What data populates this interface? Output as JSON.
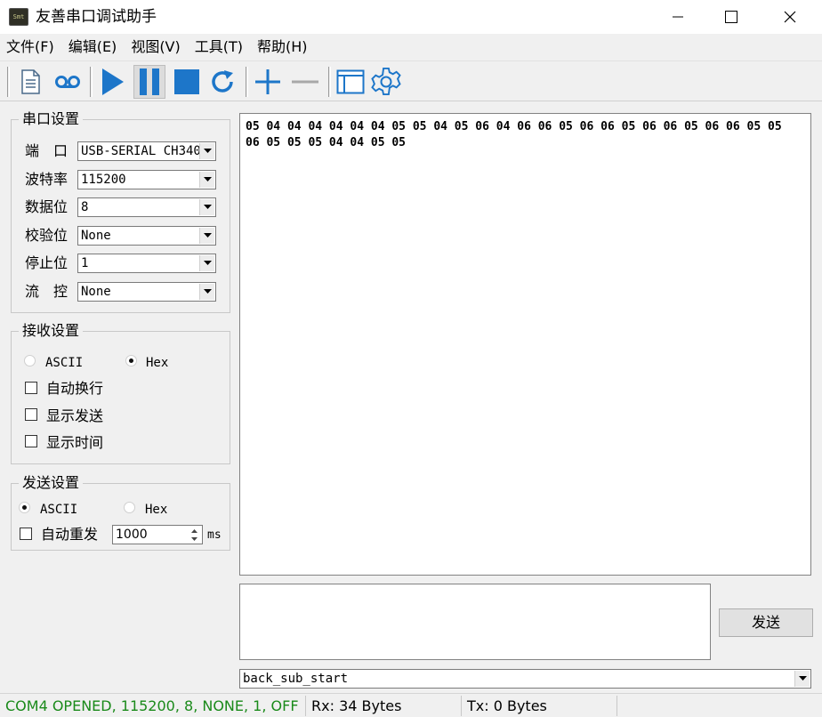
{
  "window": {
    "icon_text": "Smt",
    "title": "友善串口调试助手"
  },
  "menu": [
    "文件(F)",
    "编辑(E)",
    "视图(V)",
    "工具(T)",
    "帮助(H)"
  ],
  "toolbar": {
    "buttons": [
      "new-document-icon",
      "record-icon",
      "play-icon",
      "pause-icon",
      "stop-icon",
      "refresh-icon",
      "plus-icon",
      "minus-icon",
      "window-icon",
      "gear-icon"
    ],
    "pressed": "pause-icon",
    "accent_color": "#1d76c9"
  },
  "serial_settings": {
    "title": "串口设置",
    "rows": [
      {
        "label": "端　口",
        "value": "USB-SERIAL CH340"
      },
      {
        "label": "波特率",
        "value": "115200"
      },
      {
        "label": "数据位",
        "value": "8"
      },
      {
        "label": "校验位",
        "value": "None"
      },
      {
        "label": "停止位",
        "value": "1"
      },
      {
        "label": "流　控",
        "value": "None"
      }
    ]
  },
  "receive_settings": {
    "title": "接收设置",
    "radio_ascii": "ASCII",
    "radio_hex": "Hex",
    "selected": "Hex",
    "checkboxes": [
      "自动换行",
      "显示发送",
      "显示时间"
    ]
  },
  "send_settings": {
    "title": "发送设置",
    "radio_ascii": "ASCII",
    "radio_hex": "Hex",
    "selected": "ASCII",
    "auto_resend_label": "自动重发",
    "interval_value": "1000",
    "interval_unit": "ms"
  },
  "receive_area": {
    "text": "05 04 04 04 04 04 04 05 05 04 05 06 04 06 06 05 06 06 05 06 06 05 06 06 05 05 06 05 05 05 04 04 05 05"
  },
  "send_area": {
    "button_label": "发送",
    "history_value": "back_sub_start"
  },
  "statusbar": {
    "port_status": "COM4 OPENED, 115200, 8, NONE, 1, OFF",
    "port_status_color": "#1a8a1a",
    "rx": "Rx: 34 Bytes",
    "tx": "Tx: 0 Bytes"
  }
}
